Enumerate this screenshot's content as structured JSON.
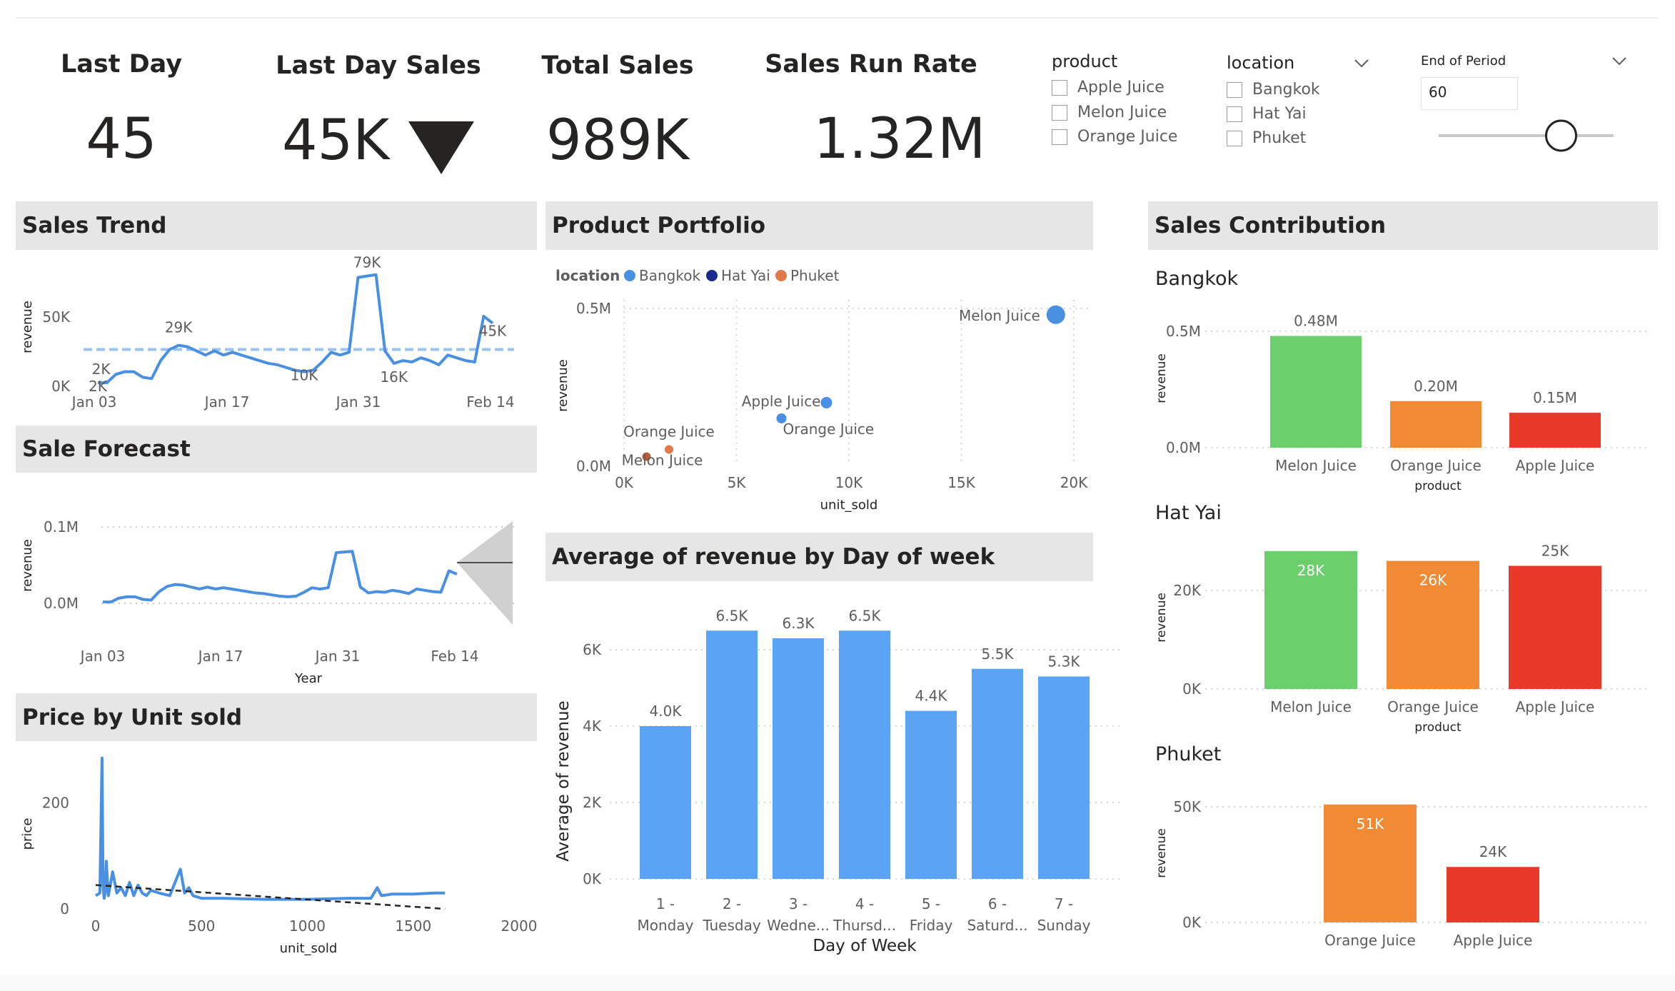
{
  "kpis": {
    "last_day": {
      "title": "Last Day",
      "value": "45"
    },
    "last_day_sales": {
      "title": "Last Day Sales",
      "value": "45K",
      "trend": "down"
    },
    "total_sales": {
      "title": "Total Sales",
      "value": "989K"
    },
    "run_rate": {
      "title": "Sales Run Rate",
      "value": "1.32M"
    }
  },
  "slicers": {
    "product": {
      "title": "product",
      "items": [
        "Apple Juice",
        "Melon Juice",
        "Orange Juice"
      ]
    },
    "location": {
      "title": "location",
      "items": [
        "Bangkok",
        "Hat Yai",
        "Phuket"
      ]
    },
    "period": {
      "title": "End of Period",
      "value": "60",
      "slider_fraction": 0.7
    }
  },
  "panels": {
    "sales_trend": "Sales Trend",
    "sale_forecast": "Sale Forecast",
    "price_by_unit": "Price by Unit sold",
    "product_portfolio": "Product Portfolio",
    "avg_revenue": "Average of revenue by Day of week",
    "sales_contribution": "Sales Contribution"
  },
  "colors": {
    "blue": "#4a90e2",
    "bar_blue": "#5ba4f5",
    "green": "#6bcf6b",
    "orange": "#f08a35",
    "red": "#e8392a",
    "navy": "#1a2a8a",
    "portfolio_orange": "#e07a4a",
    "header_gray": "#e6e6e6"
  },
  "chart_data": [
    {
      "id": "sales_trend",
      "type": "line",
      "ylabel": "revenue",
      "yticks": [
        "0K",
        "50K"
      ],
      "xticks": [
        "Jan 03",
        "Jan 17",
        "Jan 31",
        "Feb 14"
      ],
      "ylim": [
        0,
        85000
      ],
      "x": [
        1,
        2,
        3,
        4,
        5,
        6,
        7,
        8,
        9,
        10,
        11,
        12,
        13,
        14,
        15,
        16,
        17,
        18,
        19,
        20,
        21,
        22,
        23,
        24,
        25,
        26,
        27,
        28,
        29,
        30,
        31,
        32,
        33,
        34,
        35,
        36,
        37,
        38,
        39,
        40,
        41,
        42,
        43,
        44,
        45
      ],
      "values": [
        2000,
        2000,
        8000,
        10000,
        10000,
        6000,
        5000,
        18000,
        26000,
        29000,
        28000,
        25000,
        22000,
        25000,
        22000,
        24000,
        22000,
        20000,
        18000,
        16000,
        15000,
        13000,
        11000,
        10000,
        11000,
        17000,
        24000,
        22000,
        24000,
        78000,
        79000,
        80000,
        25000,
        16000,
        18000,
        17000,
        20000,
        18000,
        15000,
        22000,
        20000,
        18000,
        17000,
        50000,
        45000
      ],
      "reference_line": 26000,
      "labels": [
        {
          "text": "2K",
          "x": 2,
          "y": 2000
        },
        {
          "text": "2K",
          "x": 1,
          "y": 2000
        },
        {
          "text": "29K",
          "x": 10,
          "y": 29000
        },
        {
          "text": "10K",
          "x": 24,
          "y": 10000
        },
        {
          "text": "79K",
          "x": 31,
          "y": 79000
        },
        {
          "text": "16K",
          "x": 34,
          "y": 16000
        },
        {
          "text": "45K",
          "x": 45,
          "y": 45000
        }
      ]
    },
    {
      "id": "sale_forecast",
      "type": "line",
      "ylabel": "revenue",
      "xlabel": "Year",
      "yticks": [
        "0.0M",
        "0.1M"
      ],
      "xticks": [
        "Jan 03",
        "Jan 17",
        "Jan 31",
        "Feb 14"
      ],
      "ylim": [
        0,
        0.1
      ]
    },
    {
      "id": "price_by_unit",
      "type": "line",
      "ylabel": "price",
      "xlabel": "unit_sold",
      "xticks": [
        "0",
        "500",
        "1000",
        "1500",
        "2000"
      ],
      "yticks": [
        "0",
        "200"
      ],
      "xlim": [
        0,
        2000
      ],
      "ylim": [
        0,
        290
      ],
      "x": [
        0,
        20,
        30,
        35,
        40,
        45,
        50,
        60,
        80,
        100,
        120,
        140,
        160,
        180,
        200,
        220,
        240,
        260,
        300,
        350,
        400,
        420,
        440,
        460,
        500,
        600,
        800,
        1000,
        1200,
        1300,
        1330,
        1350,
        1400,
        1500,
        1600,
        1650
      ],
      "values": [
        25,
        30,
        285,
        40,
        20,
        30,
        90,
        25,
        70,
        30,
        40,
        25,
        50,
        25,
        45,
        30,
        25,
        35,
        30,
        25,
        75,
        30,
        40,
        25,
        20,
        20,
        18,
        18,
        20,
        20,
        40,
        25,
        28,
        28,
        30,
        30
      ],
      "trend": {
        "x": [
          0,
          1650
        ],
        "y": [
          45,
          0
        ]
      }
    },
    {
      "id": "product_portfolio",
      "type": "scatter",
      "legend_title": "location",
      "legend": [
        "Bangkok",
        "Hat Yai",
        "Phuket"
      ],
      "xlabel": "unit_sold",
      "ylabel": "revenue",
      "xticks": [
        "0K",
        "5K",
        "10K",
        "15K",
        "20K"
      ],
      "yticks": [
        "0.0M",
        "0.5M"
      ],
      "xlim": [
        0,
        20000
      ],
      "ylim": [
        0,
        0.6
      ],
      "points": [
        {
          "label": "Melon Juice",
          "x": 19200,
          "y": 0.48,
          "series": "Bangkok",
          "r": 13
        },
        {
          "label": "Apple Juice",
          "x": 9000,
          "y": 0.2,
          "series": "Bangkok",
          "r": 8
        },
        {
          "label": "Orange Juice",
          "x": 7000,
          "y": 0.15,
          "series": "Bangkok",
          "r": 7
        },
        {
          "label": "Orange Juice",
          "x": 2000,
          "y": 0.051,
          "series": "Phuket",
          "r": 6
        },
        {
          "label": "Melon Juice",
          "x": 1000,
          "y": 0.028,
          "series": "Hat Yai",
          "r": 6
        }
      ]
    },
    {
      "id": "avg_revenue",
      "type": "bar",
      "xlabel": "Day of Week",
      "ylabel": "Average of revenue",
      "yticks": [
        "0K",
        "2K",
        "4K",
        "6K"
      ],
      "ylim": [
        0,
        7000
      ],
      "categories_line1": [
        "1 -",
        "2 -",
        "3 -",
        "4 -",
        "5 -",
        "6 -",
        "7 -"
      ],
      "categories_line2": [
        "Monday",
        "Tuesday",
        "Wedne...",
        "Thursd...",
        "Friday",
        "Saturd...",
        "Sunday"
      ],
      "values": [
        4000,
        6500,
        6300,
        6500,
        4400,
        5500,
        5300
      ],
      "value_labels": [
        "4.0K",
        "6.5K",
        "6.3K",
        "6.5K",
        "4.4K",
        "5.5K",
        "5.3K"
      ]
    },
    {
      "id": "contrib_bangkok",
      "type": "bar",
      "title": "Bangkok",
      "ylabel": "revenue",
      "xlabel": "product",
      "yticks": [
        "0.0M",
        "0.5M"
      ],
      "ylim": [
        0,
        0.5
      ],
      "categories": [
        "Melon Juice",
        "Orange Juice",
        "Apple Juice"
      ],
      "values": [
        0.48,
        0.2,
        0.15
      ],
      "value_labels": [
        "0.48M",
        "0.20M",
        "0.15M"
      ]
    },
    {
      "id": "contrib_hatyai",
      "type": "bar",
      "title": "Hat Yai",
      "ylabel": "revenue",
      "xlabel": "product",
      "yticks": [
        "0K",
        "20K"
      ],
      "ylim": [
        0,
        30000
      ],
      "categories": [
        "Melon Juice",
        "Orange Juice",
        "Apple Juice"
      ],
      "values": [
        28000,
        26000,
        25000
      ],
      "value_labels": [
        "28K",
        "26K",
        "25K"
      ]
    },
    {
      "id": "contrib_phuket",
      "type": "bar",
      "title": "Phuket",
      "ylabel": "revenue",
      "yticks": [
        "0K",
        "50K"
      ],
      "ylim": [
        0,
        50000
      ],
      "categories": [
        "Orange Juice",
        "Apple Juice"
      ],
      "values": [
        51000,
        24000
      ],
      "value_labels": [
        "51K",
        "24K"
      ]
    }
  ]
}
